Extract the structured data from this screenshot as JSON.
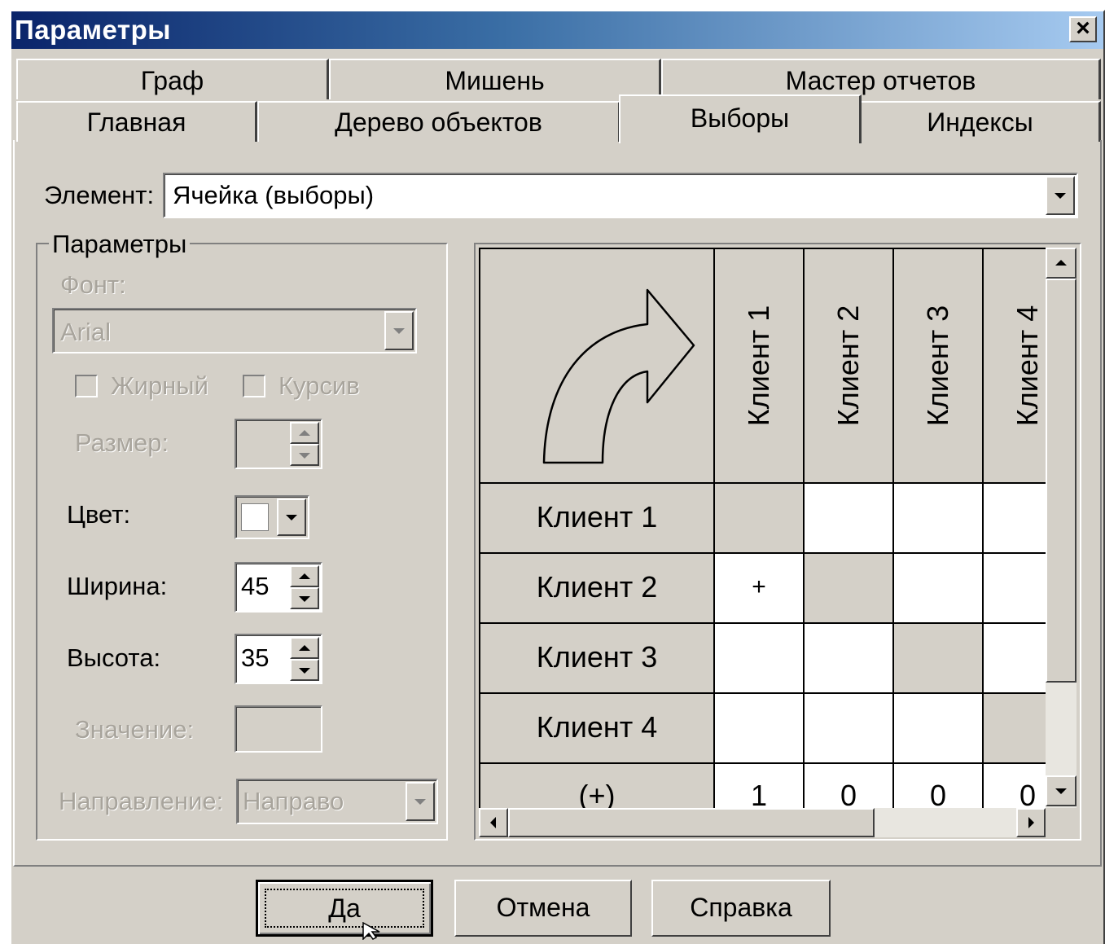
{
  "window": {
    "title": "Параметры",
    "close_label": "×"
  },
  "tabs_top": [
    "Граф",
    "Мишень",
    "Мастер отчетов"
  ],
  "tabs_bottom": [
    "Главная",
    "Дерево объектов",
    "Выборы",
    "Индексы"
  ],
  "active_tab": "Выборы",
  "element": {
    "label": "Элемент:",
    "value": "Ячейка (выборы)"
  },
  "params": {
    "group_title": "Параметры",
    "font_label": "Фонт:",
    "font_value": "Arial",
    "bold_label": "Жирный",
    "italic_label": "Курсив",
    "size_label": "Размер:",
    "size_value": "",
    "color_label": "Цвет:",
    "width_label": "Ширина:",
    "width_value": "45",
    "height_label": "Высота:",
    "height_value": "35",
    "value_label": "Значение:",
    "value_value": "",
    "direction_label": "Направление:",
    "direction_value": "Направо"
  },
  "grid": {
    "columns": [
      "Клиент 1",
      "Клиент 2",
      "Клиент 3",
      "Клиент 4"
    ],
    "rows": [
      {
        "label": "Клиент 1",
        "cells": [
          "",
          "",
          "",
          ""
        ]
      },
      {
        "label": "Клиент 2",
        "cells": [
          "+",
          "",
          "",
          ""
        ]
      },
      {
        "label": "Клиент 3",
        "cells": [
          "",
          "",
          "",
          ""
        ]
      },
      {
        "label": "Клиент 4",
        "cells": [
          "",
          "",
          "",
          ""
        ]
      }
    ],
    "total_label": "(+)",
    "totals": [
      "1",
      "0",
      "0",
      "0"
    ]
  },
  "buttons": {
    "ok": "Да",
    "cancel": "Отмена",
    "help": "Справка"
  }
}
